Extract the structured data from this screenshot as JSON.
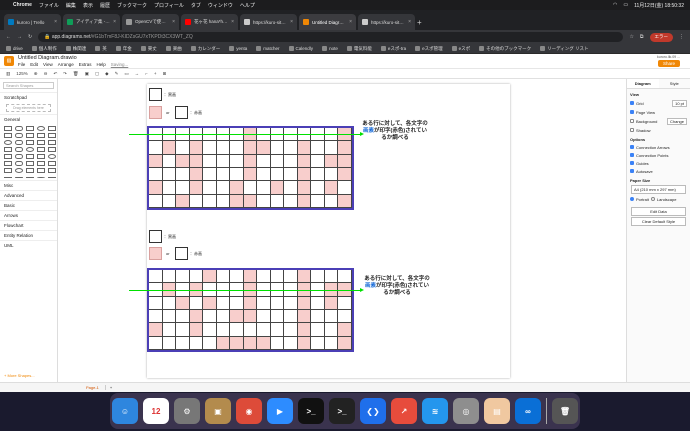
{
  "menubar": {
    "apple": "",
    "app": "Chrome",
    "items": [
      "ファイル",
      "編集",
      "表示",
      "履歴",
      "ブックマーク",
      "プロフィール",
      "タブ",
      "ウィンドウ",
      "ヘルプ"
    ],
    "clock": "11月12日(金) 18:50:32"
  },
  "tabs": [
    {
      "title": "kuroro | Trello",
      "color": "#0079bf"
    },
    {
      "title": "アイディア集 - Google スプレ",
      "color": "#0f9d58"
    },
    {
      "title": "OpenCVで使われるputText",
      "color": "#999999"
    },
    {
      "title": "花ヶ花 hana*hana* 「各一",
      "color": "#ff0000"
    },
    {
      "title": "https://kuro-site.web.app/",
      "color": "#cccccc"
    },
    {
      "title": "Untitled Diagram.drawio",
      "color": "#f08705",
      "active": true
    },
    {
      "title": "https://kuro-site.web.app/",
      "color": "#cccccc"
    }
  ],
  "address": {
    "host": "app.diagrams.net",
    "path": "/#G1bTmF8J-KIDZsGU7xTKPDt3CX3WT_ZQ",
    "profile": "エラー"
  },
  "bookmarks": [
    "drive",
    "個人制作",
    "株関連",
    "英",
    "年金",
    "東丈",
    "楽曲",
    "カレンダー",
    "yenta",
    "matcher",
    "Calendly",
    "note",
    "電気料能",
    "eスポ-tra",
    "eスポ管理",
    "eスポ",
    "その他のブックマーク",
    "リーディング リスト"
  ],
  "app": {
    "doc_title": "Untitled Diagram.drawio",
    "menu": [
      "File",
      "Edit",
      "View",
      "Arrange",
      "Extras",
      "Help"
    ],
    "saving": "Saving...",
    "share": "Share",
    "user": "kuroro.lik.09 ...",
    "zoom": "125%"
  },
  "left": {
    "search_placeholder": "Search Shapes",
    "scratchpad": "Scratchpad",
    "drop": "Drag elements here",
    "general": "General",
    "sections": [
      "Misc",
      "Advanced",
      "Basic",
      "Arrows",
      "Flowchart",
      "Entity Relation",
      "UML"
    ],
    "more": "+ More Shapes..."
  },
  "legend": {
    "white_label": "：黒画",
    "pink_label": "：赤画",
    "or": "or"
  },
  "note": {
    "pre": "ある行に対して、各文字の",
    "hl": "画素",
    "post": "が印字(赤色)されているか調べる"
  },
  "grids": [
    {
      "pink": [
        [
          0,
          7
        ],
        [
          0,
          14
        ],
        [
          1,
          1
        ],
        [
          1,
          3
        ],
        [
          1,
          7
        ],
        [
          1,
          8
        ],
        [
          1,
          11
        ],
        [
          1,
          14
        ],
        [
          2,
          0
        ],
        [
          2,
          2
        ],
        [
          2,
          3
        ],
        [
          2,
          7
        ],
        [
          2,
          11
        ],
        [
          2,
          13
        ],
        [
          2,
          14
        ],
        [
          3,
          3
        ],
        [
          3,
          7
        ],
        [
          3,
          11
        ],
        [
          3,
          14
        ],
        [
          4,
          0
        ],
        [
          4,
          3
        ],
        [
          4,
          6
        ],
        [
          4,
          9
        ],
        [
          4,
          11
        ],
        [
          4,
          13
        ],
        [
          5,
          2
        ],
        [
          5,
          6
        ],
        [
          5,
          7
        ],
        [
          5,
          11
        ],
        [
          5,
          14
        ]
      ],
      "header": [
        0,
        7
      ]
    },
    {
      "pink": [
        [
          0,
          4
        ],
        [
          0,
          7
        ],
        [
          0,
          11
        ],
        [
          1,
          1
        ],
        [
          1,
          3
        ],
        [
          1,
          7
        ],
        [
          1,
          11
        ],
        [
          1,
          13
        ],
        [
          1,
          14
        ],
        [
          2,
          2
        ],
        [
          2,
          4
        ],
        [
          2,
          7
        ],
        [
          2,
          11
        ],
        [
          2,
          13
        ],
        [
          3,
          3
        ],
        [
          3,
          6
        ],
        [
          3,
          7
        ],
        [
          3,
          11
        ],
        [
          4,
          0
        ],
        [
          4,
          3
        ],
        [
          4,
          11
        ],
        [
          4,
          14
        ],
        [
          5,
          5
        ],
        [
          5,
          6
        ],
        [
          5,
          7
        ],
        [
          5,
          8
        ],
        [
          5,
          11
        ],
        [
          5,
          14
        ]
      ]
    }
  ],
  "right": {
    "tabs": [
      "Diagram",
      "Style"
    ],
    "view": "View",
    "grid": "Grid",
    "grid_size": "10 pt",
    "page_view": "Page View",
    "background": "Background",
    "change": "Change",
    "shadow": "Shadow",
    "options": "Options",
    "opts": [
      "Connection Arrows",
      "Connection Points",
      "Guides",
      "Autosave"
    ],
    "paper": "Paper Size",
    "paper_val": "A4 (210 mm x 297 mm)",
    "portrait": "Portrait",
    "landscape": "Landscape",
    "edit": "Edit Data",
    "clear": "Clear Default Style"
  },
  "pages": {
    "tab": "Page-1"
  },
  "dock": [
    {
      "n": "finder",
      "c": "#2e86de",
      "g": "☺"
    },
    {
      "n": "calendar",
      "c": "#ffffff",
      "g": "12"
    },
    {
      "n": "system-prefs",
      "c": "#777777",
      "g": "⚙"
    },
    {
      "n": "contacts",
      "c": "#b38b4d",
      "g": "▣"
    },
    {
      "n": "chrome",
      "c": "#dd4b39",
      "g": "◉"
    },
    {
      "n": "zoom",
      "c": "#2d8cff",
      "g": "▶"
    },
    {
      "n": "terminal",
      "c": "#111111",
      "g": ">_"
    },
    {
      "n": "terminal-2",
      "c": "#222222",
      "g": ">_"
    },
    {
      "n": "vscode",
      "c": "#1f6feb",
      "g": "❮❯"
    },
    {
      "n": "pixel-editor",
      "c": "#e74c3c",
      "g": "↗"
    },
    {
      "n": "docker",
      "c": "#2496ed",
      "g": "≋"
    },
    {
      "n": "preview",
      "c": "#8e8e8e",
      "g": "◎"
    },
    {
      "n": "preview-2",
      "c": "#f0c8a0",
      "g": "▤"
    },
    {
      "n": "infinity",
      "c": "#0a6fd6",
      "g": "∞"
    },
    {
      "n": "trash",
      "c": "#555555",
      "g": "🗑"
    }
  ]
}
